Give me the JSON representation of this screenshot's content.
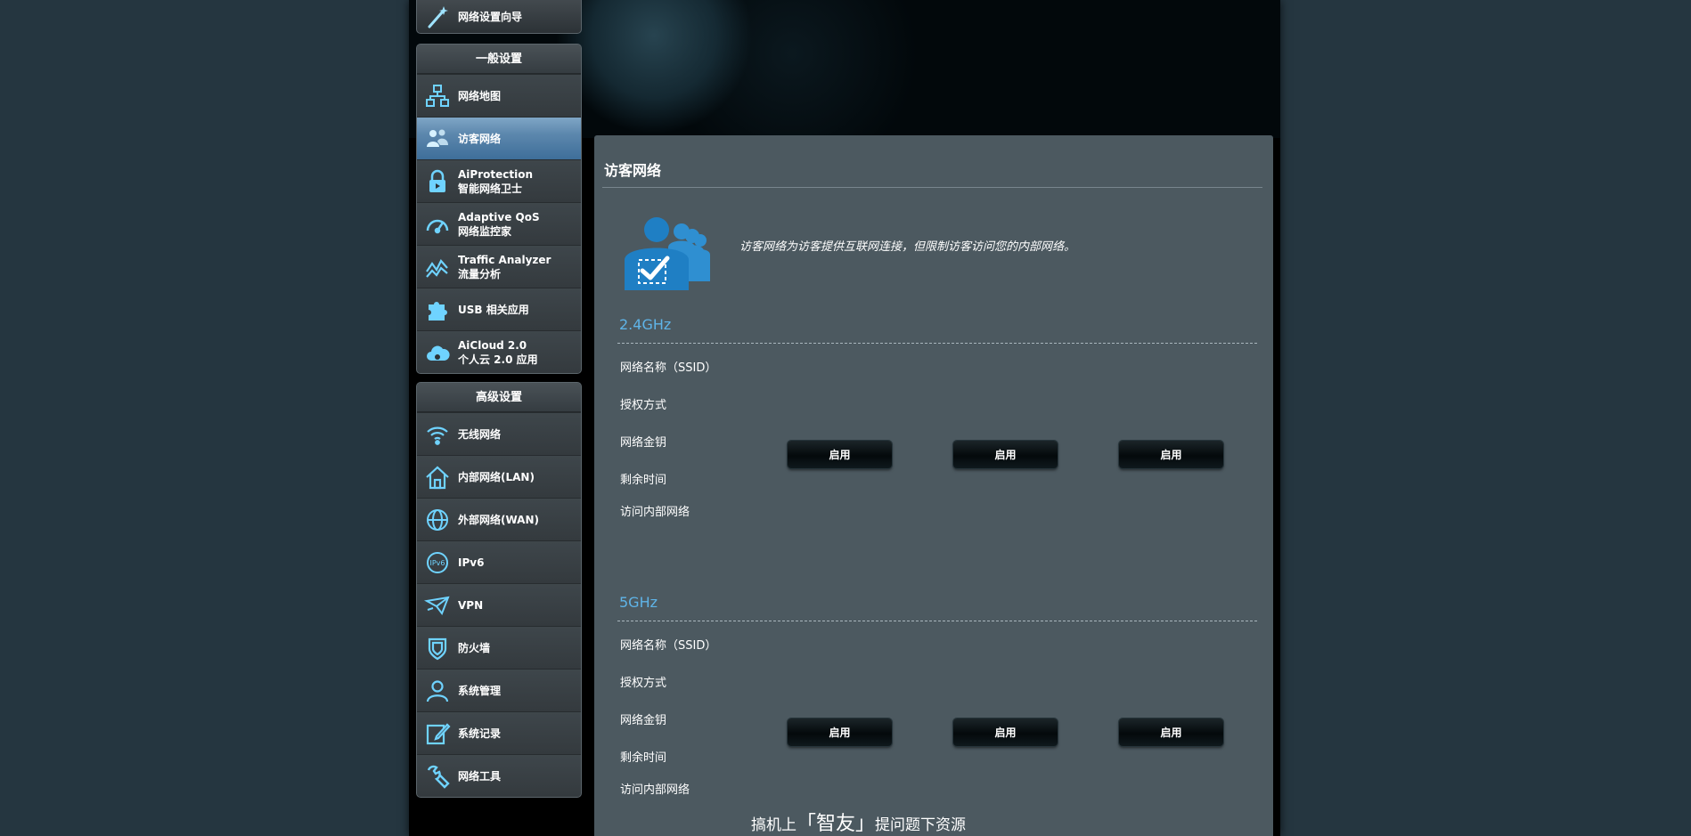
{
  "sidebar": {
    "top_item": {
      "label": "网络设置向导",
      "icon": "wizard-wand-icon"
    },
    "general": {
      "title": "一般设置",
      "items": [
        {
          "label": "网络地图",
          "sub": "",
          "icon": "network-map-icon"
        },
        {
          "label": "访客网络",
          "sub": "",
          "icon": "guest-network-icon",
          "active": true
        },
        {
          "label": "AiProtection",
          "sub": "智能网络卫士",
          "icon": "lock-icon"
        },
        {
          "label": "Adaptive QoS",
          "sub": "网络监控家",
          "icon": "speedometer-icon"
        },
        {
          "label": "Traffic Analyzer",
          "sub": "流量分析",
          "icon": "traffic-chart-icon"
        },
        {
          "label": "USB 相关应用",
          "sub": "",
          "icon": "puzzle-icon"
        },
        {
          "label": "AiCloud 2.0",
          "sub": "个人云 2.0 应用",
          "icon": "cloud-icon"
        }
      ]
    },
    "advanced": {
      "title": "高级设置",
      "items": [
        {
          "label": "无线网络",
          "icon": "wifi-icon"
        },
        {
          "label": "内部网络(LAN)",
          "icon": "home-icon"
        },
        {
          "label": "外部网络(WAN)",
          "icon": "globe-icon"
        },
        {
          "label": "IPv6",
          "icon": "ipv6-icon"
        },
        {
          "label": "VPN",
          "icon": "vpn-icon"
        },
        {
          "label": "防火墙",
          "icon": "shield-icon"
        },
        {
          "label": "系统管理",
          "icon": "admin-user-icon"
        },
        {
          "label": "系统记录",
          "icon": "log-edit-icon"
        },
        {
          "label": "网络工具",
          "icon": "wrench-icon"
        }
      ]
    }
  },
  "main": {
    "title": "访客网络",
    "intro": "访客网络为访客提供互联网连接，但限制访客访问您的内部网络。",
    "bands": [
      {
        "name": "2.4GHz",
        "fields": [
          "网络名称（SSID）",
          "授权方式",
          "网络金钥",
          "剩余时间",
          "访问内部网络"
        ],
        "buttons": [
          "启用",
          "启用",
          "启用"
        ]
      },
      {
        "name": "5GHz",
        "fields": [
          "网络名称（SSID）",
          "授权方式",
          "网络金钥",
          "剩余时间",
          "访问内部网络"
        ],
        "buttons": [
          "启用",
          "启用",
          "启用"
        ]
      }
    ]
  },
  "watermark": {
    "pre": "搞机上",
    "brand": "「智友」",
    "post": "提问题下资源"
  },
  "colors": {
    "accent": "#5fb4e8",
    "active_menu": "#4f7fa8",
    "content_bg": "#4c5960"
  }
}
